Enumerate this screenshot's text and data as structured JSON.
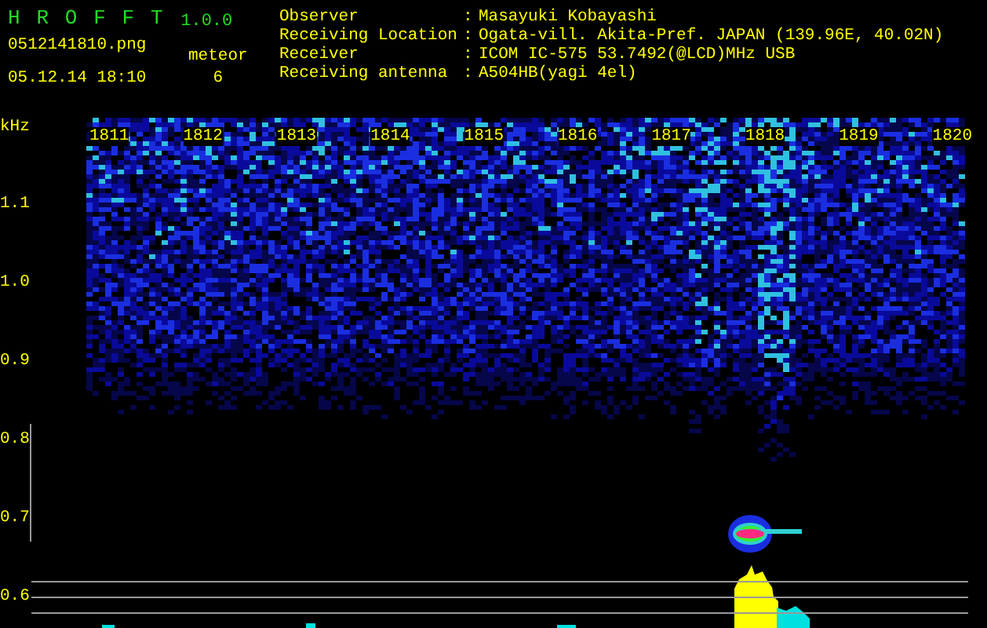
{
  "app": {
    "name": "H R O F F T",
    "version": "1.0.0"
  },
  "file": {
    "name": "0512141810.png",
    "datetime": "05.12.14 18:10"
  },
  "meteor": {
    "label": "meteor",
    "count": "6"
  },
  "station": [
    {
      "label": "Observer",
      "separator": ":",
      "value": "Masayuki Kobayashi"
    },
    {
      "label": "Receiving Location",
      "separator": ":",
      "value": "Ogata-vill. Akita-Pref. JAPAN (139.96E, 40.02N)"
    },
    {
      "label": "Receiver",
      "separator": ":",
      "value": "ICOM IC-575 53.7492(@LCD)MHz USB"
    },
    {
      "label": "Receiving antenna",
      "separator": ":",
      "value": "A504HB(yagi 4el)"
    }
  ],
  "spectrogram": {
    "unit": "kHz",
    "time_labels": [
      "1811",
      "1812",
      "1813",
      "1814",
      "1815",
      "1816",
      "1817",
      "1818",
      "1819",
      "1820"
    ],
    "freq_labels": [
      "1.1",
      "1.0",
      "0.9",
      "0.8",
      "0.7",
      "0.6"
    ]
  }
}
